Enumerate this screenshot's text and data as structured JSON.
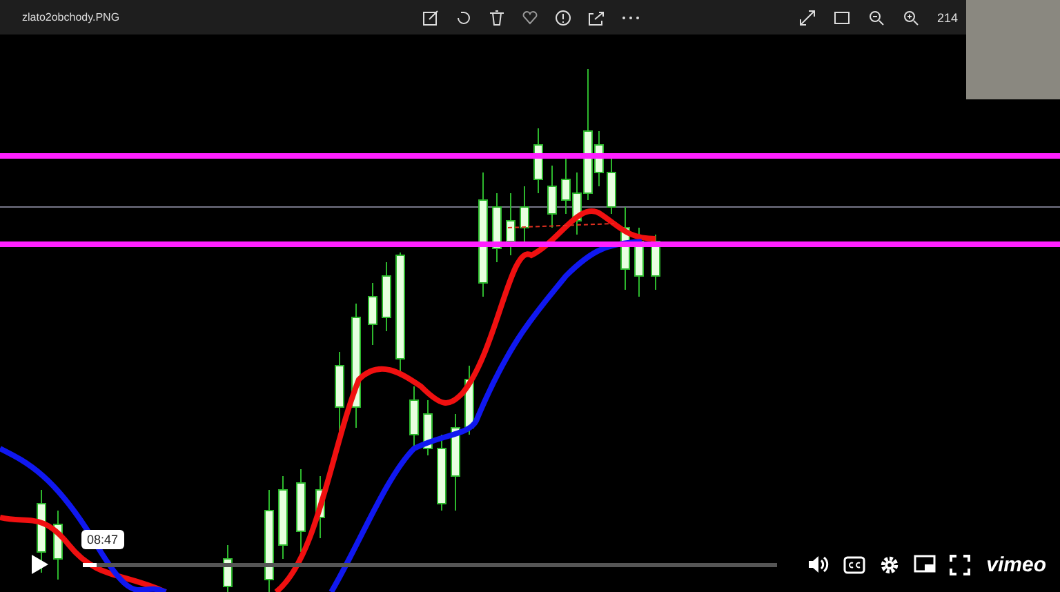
{
  "photo_viewer": {
    "file_name": "zlato2obchody.PNG",
    "zoom_level": "214"
  },
  "player": {
    "current_time": "08:47",
    "progress": {
      "level": 0.02
    },
    "logo": "vimeo"
  }
}
